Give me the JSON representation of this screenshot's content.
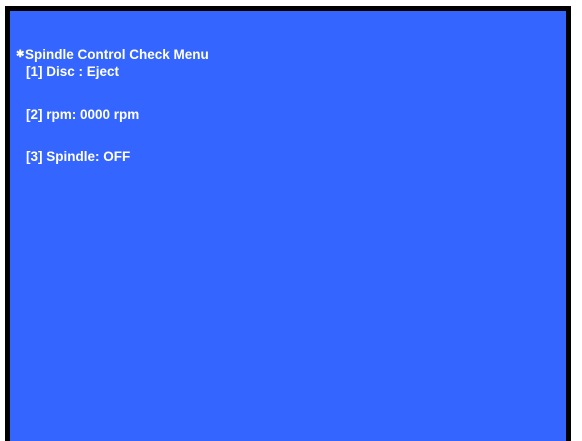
{
  "colors": {
    "screen_background": "#3565FF",
    "frame": "#000000",
    "text": "#FFFFFF"
  },
  "menu": {
    "bullet_icon": "asterisk-bullet-icon",
    "bullet_glyph": "✱",
    "title": "Spindle Control Check Menu",
    "items": [
      {
        "label": "[1] Disc : ",
        "value": "Eject"
      },
      {
        "label": "[2] rpm: ",
        "value": "0000 rpm"
      },
      {
        "label": "[3] Spindle: ",
        "value": "OFF"
      }
    ]
  }
}
